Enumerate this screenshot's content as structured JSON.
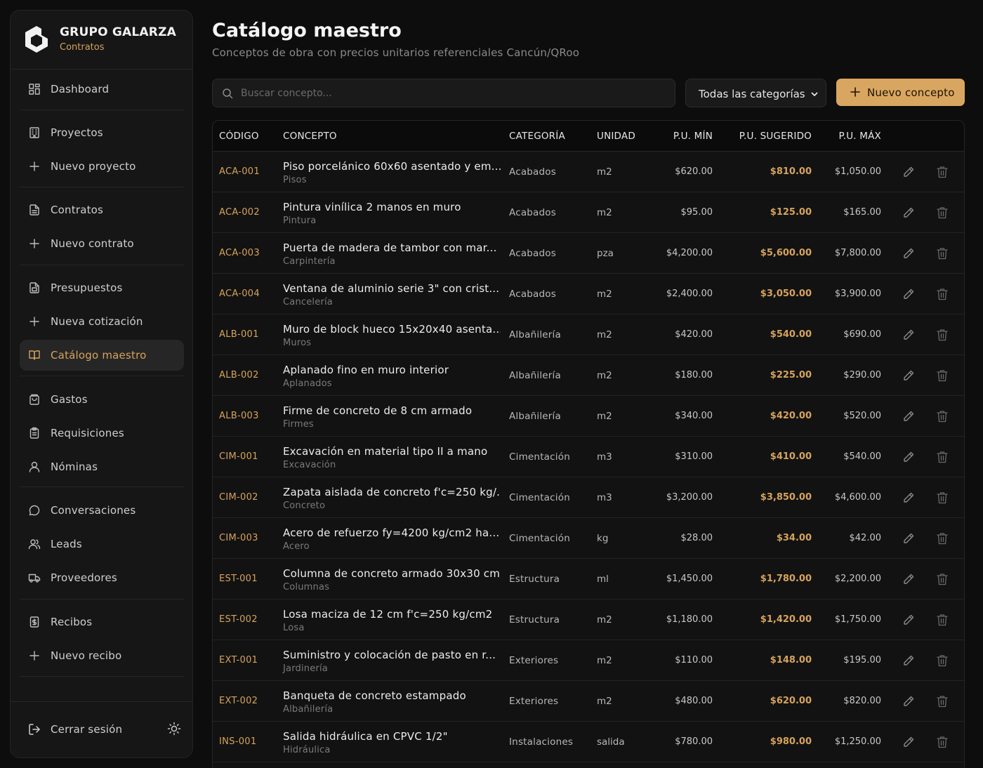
{
  "brand": {
    "name": "GRUPO GALARZA",
    "sub": "Contratos"
  },
  "nav": [
    {
      "label": "Dashboard",
      "icon": "dashboard-icon"
    },
    {
      "label": "Proyectos",
      "icon": "building-icon"
    },
    {
      "label": "Nuevo proyecto",
      "icon": "plus-icon"
    },
    {
      "label": "Contratos",
      "icon": "document-icon"
    },
    {
      "label": "Nuevo contrato",
      "icon": "plus-icon"
    },
    {
      "label": "Presupuestos",
      "icon": "calculator-doc-icon"
    },
    {
      "label": "Nueva cotización",
      "icon": "plus-icon"
    },
    {
      "label": "Catálogo maestro",
      "icon": "book-open-icon",
      "active": true
    },
    {
      "label": "Gastos",
      "icon": "wallet-icon"
    },
    {
      "label": "Requisiciones",
      "icon": "clipboard-icon"
    },
    {
      "label": "Nóminas",
      "icon": "user-icon"
    },
    {
      "label": "Conversaciones",
      "icon": "chat-bubble-icon"
    },
    {
      "label": "Leads",
      "icon": "users-icon"
    },
    {
      "label": "Proveedores",
      "icon": "truck-icon"
    },
    {
      "label": "Recibos",
      "icon": "receipt-icon"
    },
    {
      "label": "Nuevo recibo",
      "icon": "plus-icon"
    }
  ],
  "footer": {
    "logout_label": "Cerrar sesión"
  },
  "page": {
    "title": "Catálogo maestro",
    "subtitle": "Conceptos de obra con precios unitarios referenciales Cancún/QRoo"
  },
  "toolbar": {
    "search_placeholder": "Buscar concepto...",
    "category_selected": "Todas las categorías",
    "new_button": "Nuevo concepto"
  },
  "table": {
    "headers": {
      "code": "CÓDIGO",
      "concept": "CONCEPTO",
      "category": "CATEGORÍA",
      "unit": "UNIDAD",
      "pmin": "P.U. MÍN",
      "psug": "P.U. SUGERIDO",
      "pmax": "P.U. MÁX"
    },
    "rows": [
      {
        "code": "ACA-001",
        "name": "Piso porcelánico 60x60 asentado y em...",
        "sub": "Pisos",
        "category": "Acabados",
        "unit": "m2",
        "pmin": "$620.00",
        "psug": "$810.00",
        "pmax": "$1,050.00"
      },
      {
        "code": "ACA-002",
        "name": "Pintura vinílica 2 manos en muro",
        "sub": "Pintura",
        "category": "Acabados",
        "unit": "m2",
        "pmin": "$95.00",
        "psug": "$125.00",
        "pmax": "$165.00"
      },
      {
        "code": "ACA-003",
        "name": "Puerta de madera de tambor con mar...",
        "sub": "Carpintería",
        "category": "Acabados",
        "unit": "pza",
        "pmin": "$4,200.00",
        "psug": "$5,600.00",
        "pmax": "$7,800.00"
      },
      {
        "code": "ACA-004",
        "name": "Ventana de aluminio serie 3\" con crist...",
        "sub": "Cancelería",
        "category": "Acabados",
        "unit": "m2",
        "pmin": "$2,400.00",
        "psug": "$3,050.00",
        "pmax": "$3,900.00"
      },
      {
        "code": "ALB-001",
        "name": "Muro de block hueco 15x20x40 asenta...",
        "sub": "Muros",
        "category": "Albañilería",
        "unit": "m2",
        "pmin": "$420.00",
        "psug": "$540.00",
        "pmax": "$690.00"
      },
      {
        "code": "ALB-002",
        "name": "Aplanado fino en muro interior",
        "sub": "Aplanados",
        "category": "Albañilería",
        "unit": "m2",
        "pmin": "$180.00",
        "psug": "$225.00",
        "pmax": "$290.00"
      },
      {
        "code": "ALB-003",
        "name": "Firme de concreto de 8 cm armado",
        "sub": "Firmes",
        "category": "Albañilería",
        "unit": "m2",
        "pmin": "$340.00",
        "psug": "$420.00",
        "pmax": "$520.00"
      },
      {
        "code": "CIM-001",
        "name": "Excavación en material tipo II a mano",
        "sub": "Excavación",
        "category": "Cimentación",
        "unit": "m3",
        "pmin": "$310.00",
        "psug": "$410.00",
        "pmax": "$540.00"
      },
      {
        "code": "CIM-002",
        "name": "Zapata aislada de concreto f'c=250 kg/...",
        "sub": "Concreto",
        "category": "Cimentación",
        "unit": "m3",
        "pmin": "$3,200.00",
        "psug": "$3,850.00",
        "pmax": "$4,600.00"
      },
      {
        "code": "CIM-003",
        "name": "Acero de refuerzo fy=4200 kg/cm2 ha...",
        "sub": "Acero",
        "category": "Cimentación",
        "unit": "kg",
        "pmin": "$28.00",
        "psug": "$34.00",
        "pmax": "$42.00"
      },
      {
        "code": "EST-001",
        "name": "Columna de concreto armado 30x30 cm",
        "sub": "Columnas",
        "category": "Estructura",
        "unit": "ml",
        "pmin": "$1,450.00",
        "psug": "$1,780.00",
        "pmax": "$2,200.00"
      },
      {
        "code": "EST-002",
        "name": "Losa maciza de 12 cm f'c=250 kg/cm2",
        "sub": "Losa",
        "category": "Estructura",
        "unit": "m2",
        "pmin": "$1,180.00",
        "psug": "$1,420.00",
        "pmax": "$1,750.00"
      },
      {
        "code": "EXT-001",
        "name": "Suministro y colocación de pasto en r...",
        "sub": "Jardinería",
        "category": "Exteriores",
        "unit": "m2",
        "pmin": "$110.00",
        "psug": "$148.00",
        "pmax": "$195.00"
      },
      {
        "code": "EXT-002",
        "name": "Banqueta de concreto estampado",
        "sub": "Albañilería",
        "category": "Exteriores",
        "unit": "m2",
        "pmin": "$480.00",
        "psug": "$620.00",
        "pmax": "$820.00"
      },
      {
        "code": "INS-001",
        "name": "Salida hidráulica en CPVC 1/2\"",
        "sub": "Hidráulica",
        "category": "Instalaciones",
        "unit": "salida",
        "pmin": "$780.00",
        "psug": "$980.00",
        "pmax": "$1,250.00"
      }
    ]
  },
  "colors": {
    "accent": "#d9a661",
    "background": "#0d0d0d",
    "sidebar": "#161616"
  }
}
